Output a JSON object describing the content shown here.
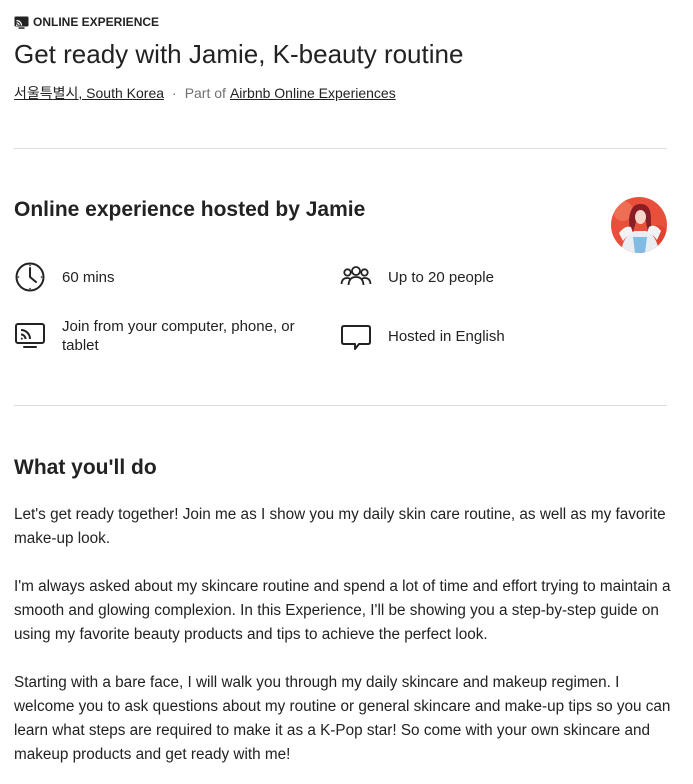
{
  "header": {
    "badge_icon": "screen-cast-icon",
    "badge": "ONLINE EXPERIENCE",
    "title": "Get ready with Jamie, K-beauty routine",
    "location_link": "서울특별시, South Korea",
    "separator": "·",
    "part_of_label": "Part of",
    "airbnb_link": "Airbnb Online Experiences"
  },
  "host": {
    "title": "Online experience hosted by Jamie",
    "avatar_icon": "host-avatar",
    "features": [
      {
        "icon": "clock-icon",
        "text": "60 mins"
      },
      {
        "icon": "people-group-icon",
        "text": "Up to 20 people"
      },
      {
        "icon": "screen-cast-icon",
        "text": "Join from your computer, phone, or tablet"
      },
      {
        "icon": "speech-bubble-icon",
        "text": "Hosted in English"
      }
    ]
  },
  "what_youll_do": {
    "title": "What you'll do",
    "paragraphs": [
      "Let's get ready together! Join me as I show you my daily skin care routine, as well as my favorite make-up look.",
      "I'm always asked about my skincare routine and spend a lot of time and effort trying to maintain a smooth and glowing complexion. In this Experience, I'll be showing you a step-by-step guide on using my favorite beauty products and tips to achieve the perfect look.",
      "Starting with a bare face, I will walk you through my daily skincare and makeup regimen. I welcome you to ask questions about my routine or general skincare and make-up tips so you can learn what steps are required to make it as a K-Pop star! So come with your own skincare and makeup products and get ready with me!"
    ]
  },
  "colors": {
    "text": "#222222",
    "muted": "#717171",
    "divider": "#dddddd",
    "avatar_bg": "#e8503c"
  }
}
